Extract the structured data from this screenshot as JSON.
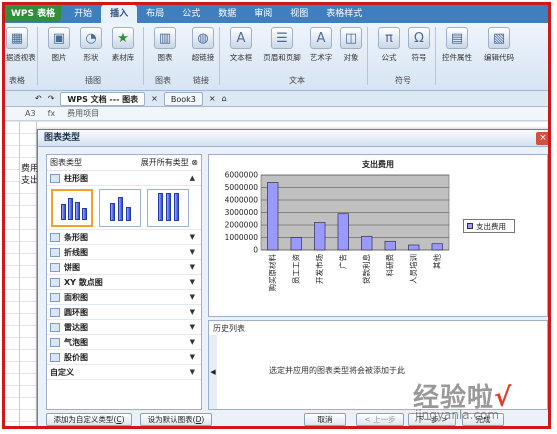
{
  "app": {
    "button": "WPS 表格"
  },
  "menu": {
    "tabs": [
      "开始",
      "插入",
      "布局",
      "公式",
      "数据",
      "审阅",
      "视图",
      "表格样式"
    ],
    "active": "插入"
  },
  "ribbon": {
    "items": [
      "数据透视表",
      "图片",
      "形状",
      "素材库",
      "图表",
      "超链接",
      "文本框",
      "页眉和页脚",
      "艺术字",
      "对象",
      "公式",
      "符号",
      "控件属性",
      "编辑代码"
    ],
    "groups": [
      "表格",
      "插图",
      "图表",
      "链接",
      "文本",
      "符号"
    ]
  },
  "docbar": {
    "tabs": [
      "WPS 文档 --- 图表",
      "Book3"
    ]
  },
  "formula": {
    "cell": "A3",
    "value": "费用项目"
  },
  "sheet": {
    "lines": [
      "费用",
      "支出"
    ]
  },
  "dialog": {
    "title": "图表类型",
    "left": {
      "header": "图表类型",
      "expand": "展开所有类型",
      "categories": [
        "柱形图",
        "条形图",
        "折线图",
        "饼图",
        "XY 散点图",
        "面积图",
        "圆环图",
        "雷达图",
        "气泡图",
        "股价图",
        "自定义"
      ]
    },
    "chart_data": {
      "type": "bar",
      "title": "支出费用",
      "categories": [
        "购买原材料",
        "员工工资",
        "开发市场",
        "广告",
        "贷款利息",
        "科研费",
        "人员培训",
        "其他"
      ],
      "values": [
        5400000,
        1000000,
        2200000,
        2900000,
        1100000,
        700000,
        400000,
        500000
      ],
      "ylim": [
        0,
        6000000
      ],
      "yticks": [
        "0",
        "1000000",
        "2000000",
        "3000000",
        "4000000",
        "5000000",
        "6000000"
      ],
      "series": [
        {
          "name": "支出费用"
        }
      ],
      "legend": "right",
      "colors": {
        "bar": "#9999ff",
        "plot_bg": "#c0c0c0"
      }
    },
    "history": {
      "label": "历史列表",
      "text": "选定并应用的图表类型将会被添加于此"
    },
    "buttons": {
      "add_custom": "添加为自定义类型",
      "set_default": "设为默认图表",
      "cancel": "取消",
      "prev": "上一步",
      "next": "下一步",
      "finish": "完成"
    }
  },
  "watermark": {
    "main": "经验啦",
    "sub": "jingyanla.com"
  }
}
